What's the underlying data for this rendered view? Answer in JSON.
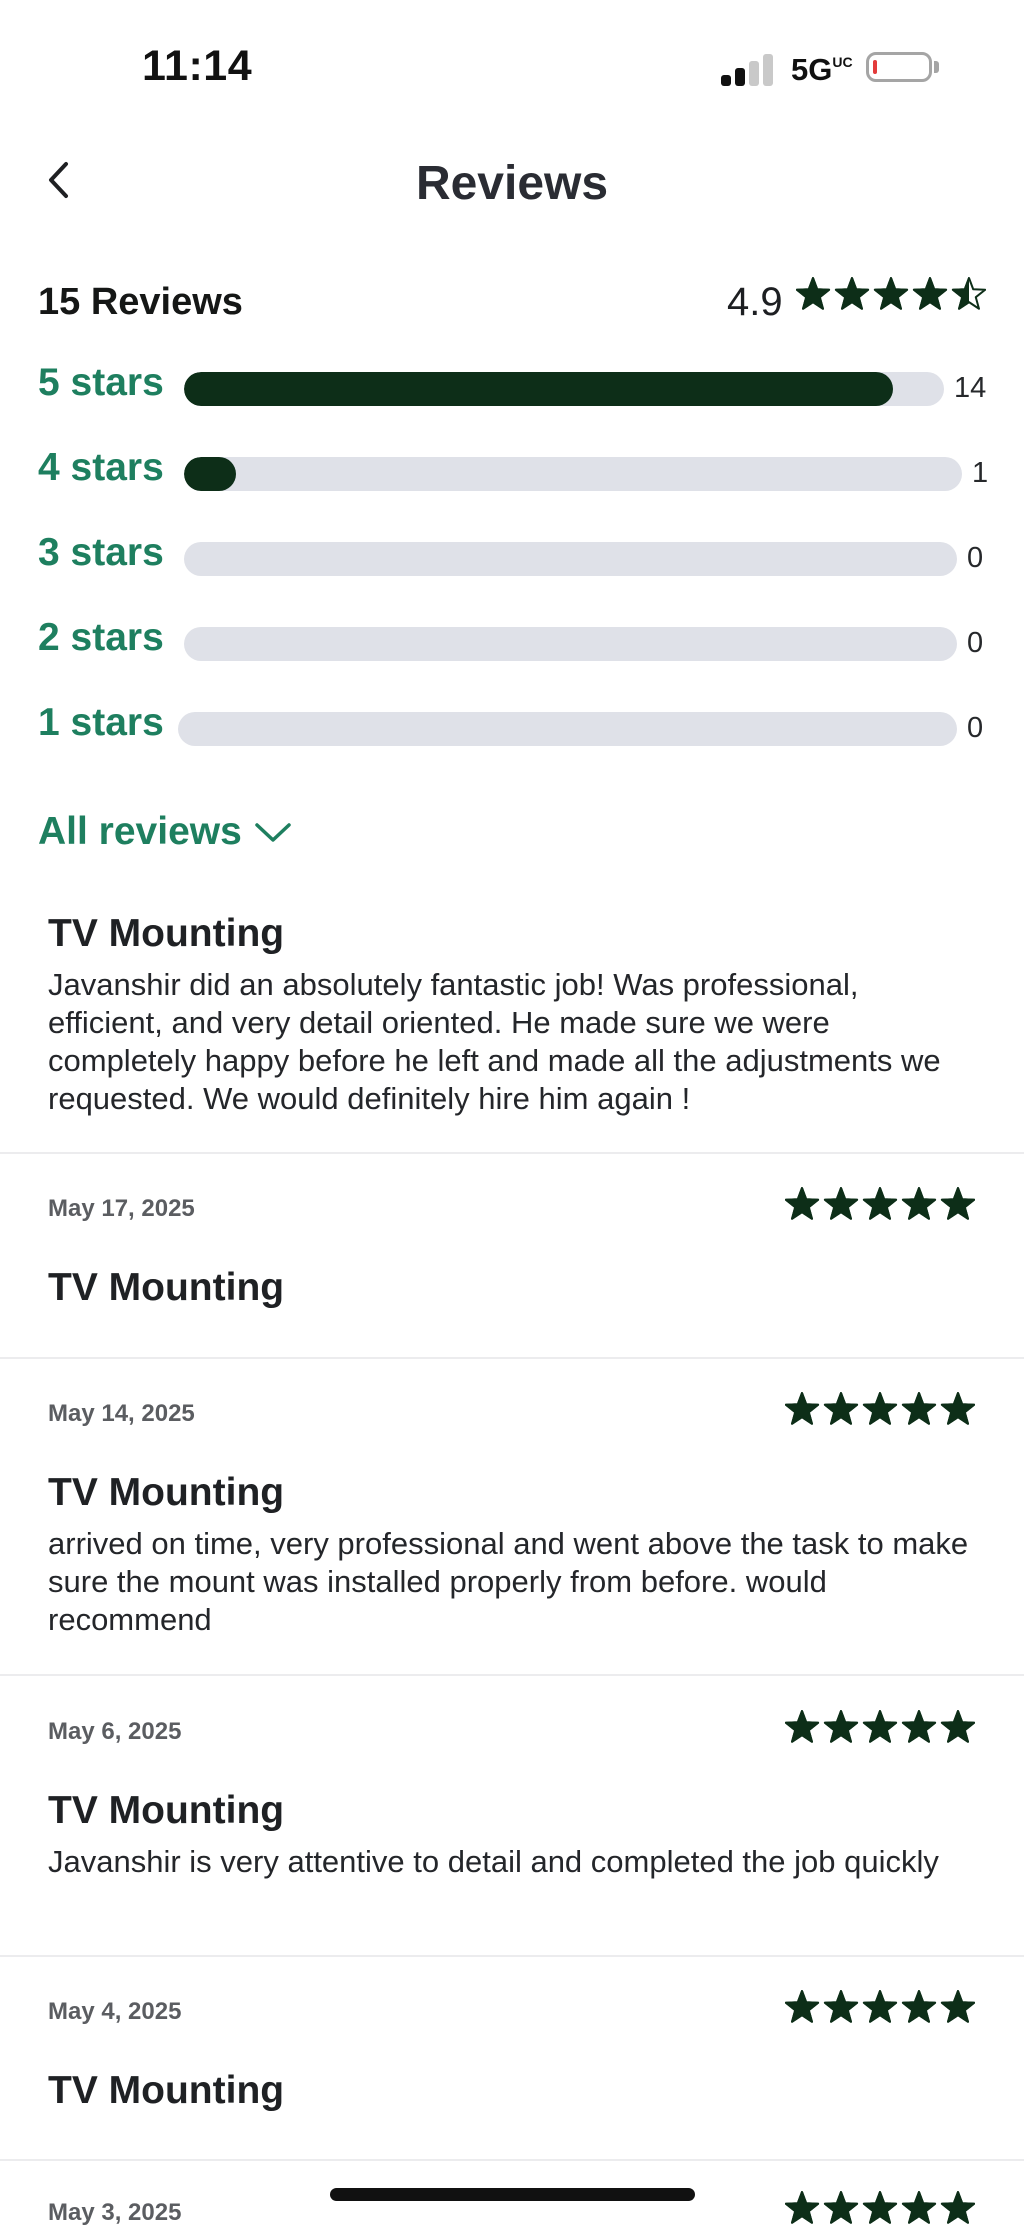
{
  "status_bar": {
    "time": "11:14",
    "network": "5G",
    "network_suffix": "UC"
  },
  "header": {
    "title": "Reviews",
    "back_icon": "chevron-left-icon"
  },
  "summary": {
    "count_label": "15 Reviews",
    "average": "4.9",
    "average_value": 4.9,
    "bars": [
      {
        "label": "5 stars",
        "count": "14",
        "fraction": 0.933
      },
      {
        "label": "4 stars",
        "count": "1",
        "fraction": 0.067
      },
      {
        "label": "3 stars",
        "count": "0",
        "fraction": 0
      },
      {
        "label": "2 stars",
        "count": "0",
        "fraction": 0
      },
      {
        "label": "1 stars",
        "count": "0",
        "fraction": 0
      }
    ]
  },
  "filter": {
    "label": "All reviews",
    "icon": "chevron-down-icon"
  },
  "reviews": [
    {
      "title": "TV Mounting",
      "text": "Javanshir did an absolutely fantastic job! Was professional, efficient, and very detail oriented. He made sure we were completely happy before he left and made all the adjustments we requested. We would definitely hire him again !"
    },
    {
      "date": "May 17, 2025",
      "rating": 5,
      "title": "TV Mounting"
    },
    {
      "date": "May 14, 2025",
      "rating": 5,
      "title": "TV Mounting",
      "text": "arrived on time, very professional and went above the task to make sure the mount was installed properly from before. would recommend"
    },
    {
      "date": "May 6, 2025",
      "rating": 5,
      "title": "TV Mounting",
      "text": "Javanshir is very attentive to detail and completed the job quickly"
    },
    {
      "date": "May 4, 2025",
      "rating": 5,
      "title": "TV Mounting"
    },
    {
      "date": "May 3, 2025",
      "rating": 5
    }
  ],
  "colors": {
    "accent": "#1e7f5f",
    "star": "#0d2e18",
    "bar_track": "#dfe1e8"
  }
}
